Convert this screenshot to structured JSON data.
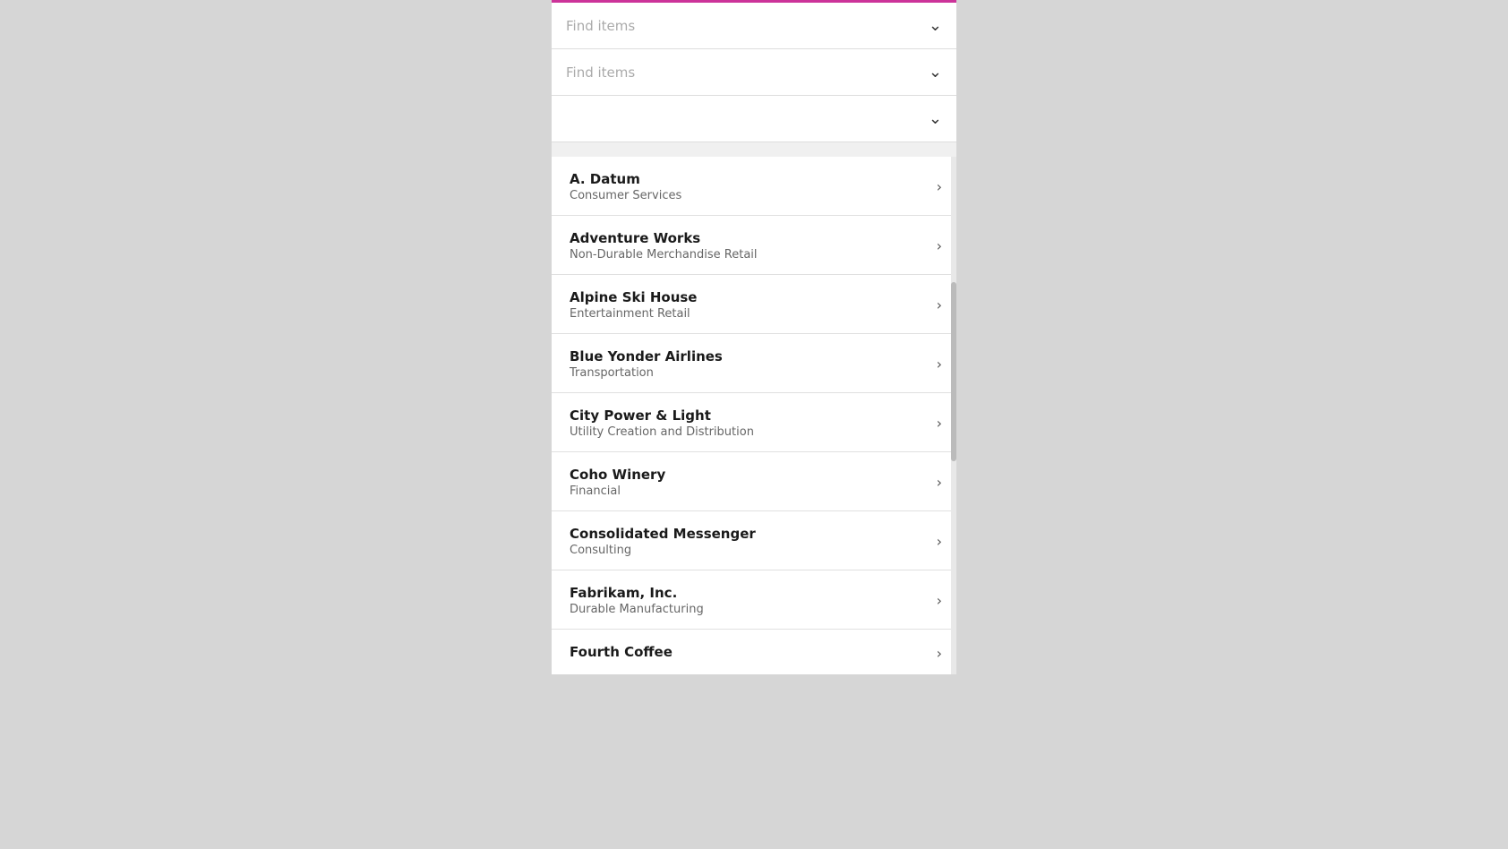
{
  "filters": [
    {
      "placeholder": "Find items",
      "hasText": true
    },
    {
      "placeholder": "Find items",
      "hasText": true
    },
    {
      "placeholder": "",
      "hasText": false
    }
  ],
  "items": [
    {
      "name": "A. Datum",
      "category": "Consumer Services"
    },
    {
      "name": "Adventure Works",
      "category": "Non-Durable Merchandise Retail"
    },
    {
      "name": "Alpine Ski House",
      "category": "Entertainment Retail"
    },
    {
      "name": "Blue Yonder Airlines",
      "category": "Transportation"
    },
    {
      "name": "City Power & Light",
      "category": "Utility Creation and Distribution"
    },
    {
      "name": "Coho Winery",
      "category": "Financial"
    },
    {
      "name": "Consolidated Messenger",
      "category": "Consulting"
    },
    {
      "name": "Fabrikam, Inc.",
      "category": "Durable Manufacturing"
    },
    {
      "name": "Fourth Coffee",
      "category": ""
    }
  ],
  "chevron_char": "⌄",
  "arrow_char": "›"
}
